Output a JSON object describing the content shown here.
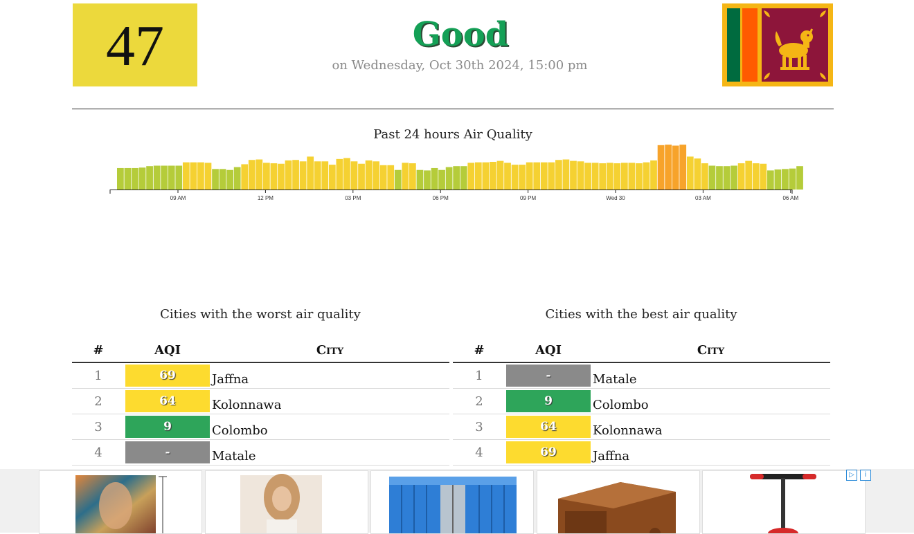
{
  "current": {
    "aqi": "47",
    "status": "Good",
    "timestamp": "on Wednesday, Oct 30th 2024, 15:00 pm",
    "status_color": "#14a056",
    "aqi_box_color": "#ecd93c"
  },
  "chart_data": {
    "type": "bar",
    "title": "Past 24 hours Air Quality",
    "x_tick_labels": [
      "09 AM",
      "12 PM",
      "03 PM",
      "06 PM",
      "09 PM",
      "Wed 30",
      "03 AM",
      "06 AM"
    ],
    "values": [
      45,
      45,
      45,
      46,
      49,
      50,
      50,
      50,
      50,
      57,
      57,
      57,
      56,
      43,
      43,
      41,
      47,
      53,
      62,
      63,
      56,
      55,
      54,
      61,
      62,
      59,
      69,
      59,
      59,
      52,
      64,
      66,
      59,
      54,
      61,
      59,
      51,
      51,
      41,
      56,
      55,
      41,
      40,
      45,
      41,
      47,
      49,
      49,
      56,
      57,
      57,
      58,
      60,
      56,
      52,
      52,
      57,
      57,
      57,
      57,
      62,
      63,
      60,
      59,
      56,
      56,
      55,
      56,
      55,
      56,
      56,
      55,
      57,
      61,
      93,
      94,
      92,
      94,
      69,
      65,
      55,
      50,
      49,
      49,
      50,
      55,
      60,
      55,
      54,
      40,
      42,
      43,
      44,
      49
    ],
    "ylim": [
      0,
      100
    ],
    "colors": {
      "good": "#b5cc3a",
      "moderate": "#f5d132",
      "unhealthy_sensitive": "#f7a32b"
    }
  },
  "worst": {
    "title": "Cities with the worst air quality",
    "headers": {
      "rank": "#",
      "aqi": "AQI",
      "city": "City"
    },
    "rows": [
      {
        "rank": "1",
        "aqi": "69",
        "city": "Jaffna",
        "color": "#fddb2f"
      },
      {
        "rank": "2",
        "aqi": "64",
        "city": "Kolonnawa",
        "color": "#fddb2f"
      },
      {
        "rank": "3",
        "aqi": "9",
        "city": "Colombo",
        "color": "#2ea55a"
      },
      {
        "rank": "4",
        "aqi": "-",
        "city": "Matale",
        "color": "#8a8a8a"
      }
    ]
  },
  "best": {
    "title": "Cities with the best air quality",
    "headers": {
      "rank": "#",
      "aqi": "AQI",
      "city": "City"
    },
    "rows": [
      {
        "rank": "1",
        "aqi": "-",
        "city": "Matale",
        "color": "#8a8a8a"
      },
      {
        "rank": "2",
        "aqi": "9",
        "city": "Colombo",
        "color": "#2ea55a"
      },
      {
        "rank": "3",
        "aqi": "64",
        "city": "Kolonnawa",
        "color": "#fddb2f"
      },
      {
        "rank": "4",
        "aqi": "69",
        "city": "Jaffna",
        "color": "#fddb2f"
      }
    ]
  },
  "ad_icons": [
    "adchoices-icon",
    "info-icon"
  ]
}
